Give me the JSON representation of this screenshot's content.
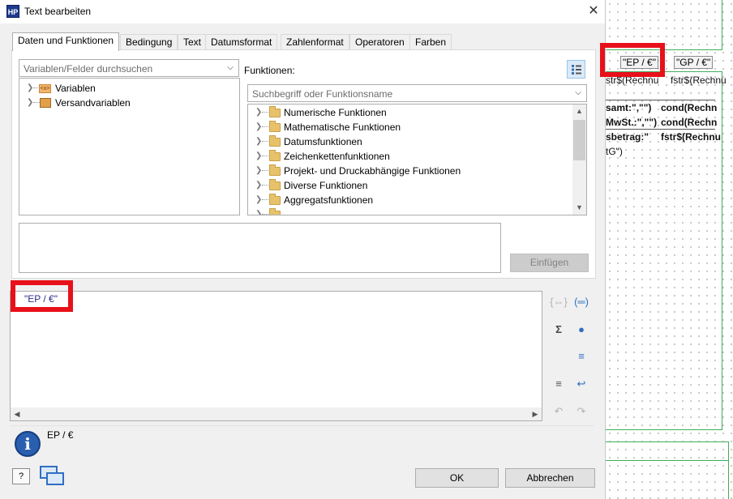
{
  "window": {
    "app_icon_text": "HP",
    "title": "Text bearbeiten",
    "close_glyph": "✕"
  },
  "tabs": [
    {
      "label": "Daten und Funktionen",
      "active": true
    },
    {
      "label": "Bedingung",
      "active": false
    },
    {
      "label": "Text",
      "active": false
    },
    {
      "label": "Datumsformat",
      "active": false
    },
    {
      "label": "Zahlenformat",
      "active": false
    },
    {
      "label": "Operatoren",
      "active": false
    },
    {
      "label": "Farben",
      "active": false
    }
  ],
  "variables": {
    "search_placeholder": "Variablen/Felder durchsuchen",
    "tree": [
      "Variablen",
      "Versandvariablen"
    ]
  },
  "functions": {
    "label": "Funktionen:",
    "search_placeholder": "Suchbegriff oder Funktionsname",
    "tree": [
      "Numerische Funktionen",
      "Mathematische Funktionen",
      "Datumsfunktionen",
      "Zeichenkettenfunktionen",
      "Projekt- und Druckabhängige Funktionen",
      "Diverse Funktionen",
      "Aggregatsfunktionen"
    ]
  },
  "insert_button": "Einfügen",
  "editor": {
    "content": "\"EP / €\""
  },
  "info": {
    "icon_text": "i",
    "text": "EP / €"
  },
  "buttons": {
    "help": "?",
    "ok": "OK",
    "cancel": "Abbrechen"
  },
  "designer": {
    "field_ep": "\"EP / €\"",
    "field_gp": "\"GP / €\"",
    "row1a": "str$(Rechnu",
    "row1b": "fstr$(Rechnu",
    "row2a": "samt:\",\"\")",
    "row2b": "cond(Rechn",
    "row3a": "MwSt.:\",\"\")",
    "row3b": "cond(Rechn",
    "row4a": "sbetrag:\"",
    "row4b": "fstr$(Rechnu",
    "row5": "tG\")"
  },
  "colors": {
    "highlight": "#e8101a",
    "designer_guides": "#3fae5a"
  }
}
